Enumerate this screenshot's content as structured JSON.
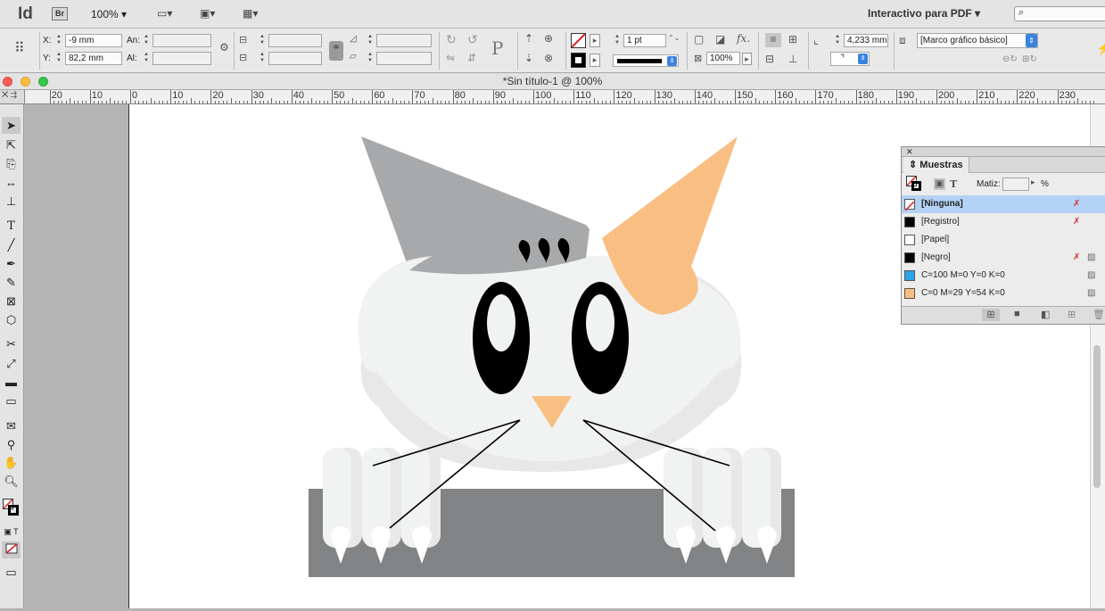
{
  "app": {
    "logo": "Id",
    "bridge": "Br",
    "zoom": "100% ▾",
    "workspace": "Interactivo para PDF ▾",
    "search_icon": "⌕"
  },
  "control": {
    "x_label": "X:",
    "x_value": "-9 mm",
    "y_label": "Y:",
    "y_value": "82,2 mm",
    "w_label": "An:",
    "w_value": "",
    "h_label": "Al:",
    "h_value": "",
    "stroke_weight": "1 pt",
    "ref_w": "4,233 mm",
    "opacity": "100%",
    "object_style": "[Marco gráfico básico]"
  },
  "document": {
    "title": "*Sin título-1 @ 100%"
  },
  "ruler": [
    "20",
    "10",
    "0",
    "10",
    "20",
    "30",
    "40",
    "50",
    "60",
    "70",
    "80",
    "90",
    "100",
    "110",
    "120",
    "130",
    "140",
    "150",
    "160",
    "170",
    "180",
    "190",
    "200",
    "210",
    "220",
    "230"
  ],
  "swatches": {
    "tab": "Muestras",
    "tint_label": "Matiz:",
    "tint_value": "",
    "percent": "%",
    "items": [
      {
        "name": "[Ninguna]",
        "color": "none",
        "selected": true
      },
      {
        "name": "[Registro]",
        "color": "#000000",
        "selected": false
      },
      {
        "name": "[Papel]",
        "color": "#ffffff",
        "selected": false
      },
      {
        "name": "[Negro]",
        "color": "#000000",
        "selected": false
      },
      {
        "name": "C=100 M=0 Y=0 K=0",
        "color": "#2ba3e8",
        "selected": false
      },
      {
        "name": "C=0 M=29 Y=54 K=0",
        "color": "#f9be82",
        "selected": false
      }
    ]
  },
  "tools": [
    "selection-tool",
    "direct-selection-tool",
    "page-tool",
    "gap-tool",
    "content-collector-tool",
    "type-tool",
    "line-tool",
    "pen-tool",
    "pencil-tool",
    "rectangle-frame-tool",
    "polygon-tool",
    "scissors-tool",
    "free-transform-tool",
    "gradient-swatch-tool",
    "gradient-feather-tool",
    "note-tool",
    "eyedropper-tool",
    "hand-tool",
    "zoom-tool"
  ],
  "colors": {
    "ear_orange": "#f9be82",
    "head_gray": "#f1f2f2",
    "ear_gray": "#a8a9ab",
    "box_gray": "#828385",
    "selection_blue": "#b4d2f5"
  }
}
